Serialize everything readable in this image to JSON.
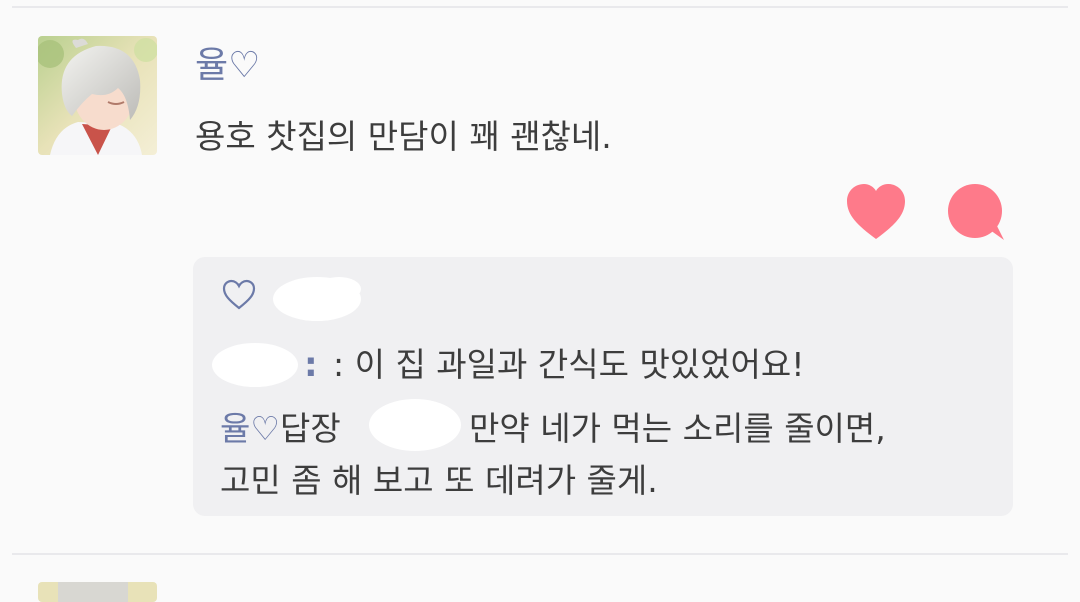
{
  "post": {
    "author": "율♡",
    "text": "용호 찻집의 만담이 꽤 괜찮네."
  },
  "actions": {
    "like_icon": "heart-icon",
    "comment_icon": "speech-bubble-icon",
    "accent_color": "#fe7a8a"
  },
  "comments": {
    "commenter_line": ": 이 집 과일과 간식도 맛있었어요!",
    "reply_author": "율♡",
    "reply_label": "답장",
    "reply_text_1": "만약 네가 먹는 소리를 줄이면,",
    "reply_text_2": "고민 좀 해 보고 또 데려가 줄게."
  },
  "colors": {
    "author": "#6c7aa8",
    "text": "#3d3d3d",
    "comment_bg": "#f0f0f2"
  }
}
